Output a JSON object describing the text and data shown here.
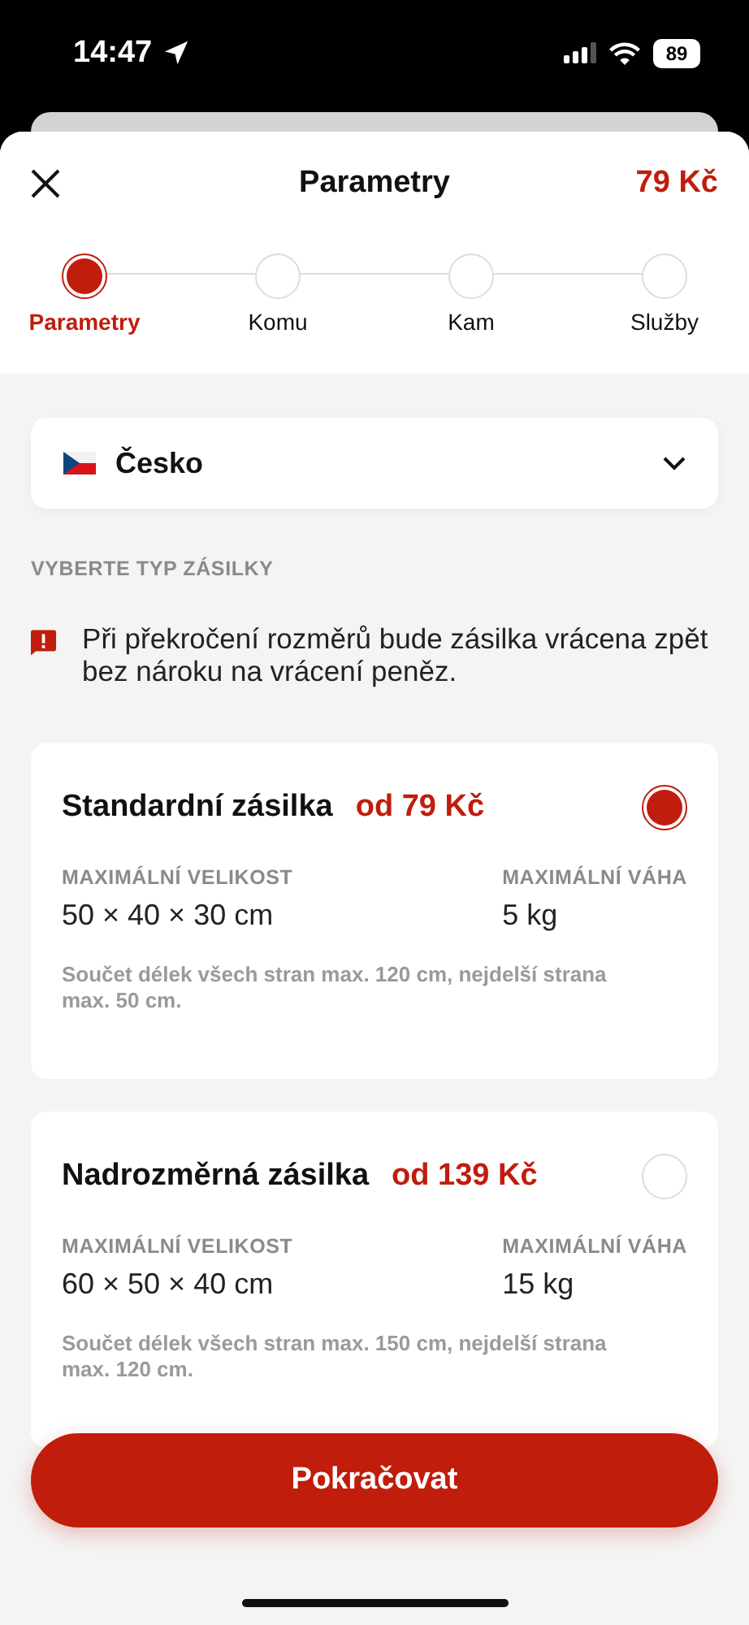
{
  "status_bar": {
    "time": "14:47",
    "battery": "89"
  },
  "header": {
    "title": "Parametry",
    "price": "79 Kč"
  },
  "steps": [
    {
      "label": "Parametry",
      "selected": true
    },
    {
      "label": "Komu",
      "selected": false
    },
    {
      "label": "Kam",
      "selected": false
    },
    {
      "label": "Služby",
      "selected": false
    }
  ],
  "country": {
    "value": "Česko"
  },
  "section_label": "VYBERTE TYP ZÁSILKY",
  "warning": "Při překročení rozměrů bude zásilka vrácena zpět bez nároku na vrácení peněz.",
  "parcels": [
    {
      "title": "Standardní zásilka",
      "price": "od 79 Kč",
      "selected": true,
      "size_label": "MAXIMÁLNÍ VELIKOST",
      "size": "50 × 40 × 30 cm",
      "weight_label": "MAXIMÁLNÍ VÁHA",
      "weight": "5 kg",
      "note": "Součet délek všech stran max. 120 cm, nejdelší strana max. 50 cm."
    },
    {
      "title": "Nadrozměrná zásilka",
      "price": "od 139 Kč",
      "selected": false,
      "size_label": "MAXIMÁLNÍ VELIKOST",
      "size": "60 × 50 × 40 cm",
      "weight_label": "MAXIMÁLNÍ VÁHA",
      "weight": "15 kg",
      "note": "Součet délek všech stran max. 150 cm, nejdelší strana max. 120 cm."
    }
  ],
  "button": "Pokračovat"
}
